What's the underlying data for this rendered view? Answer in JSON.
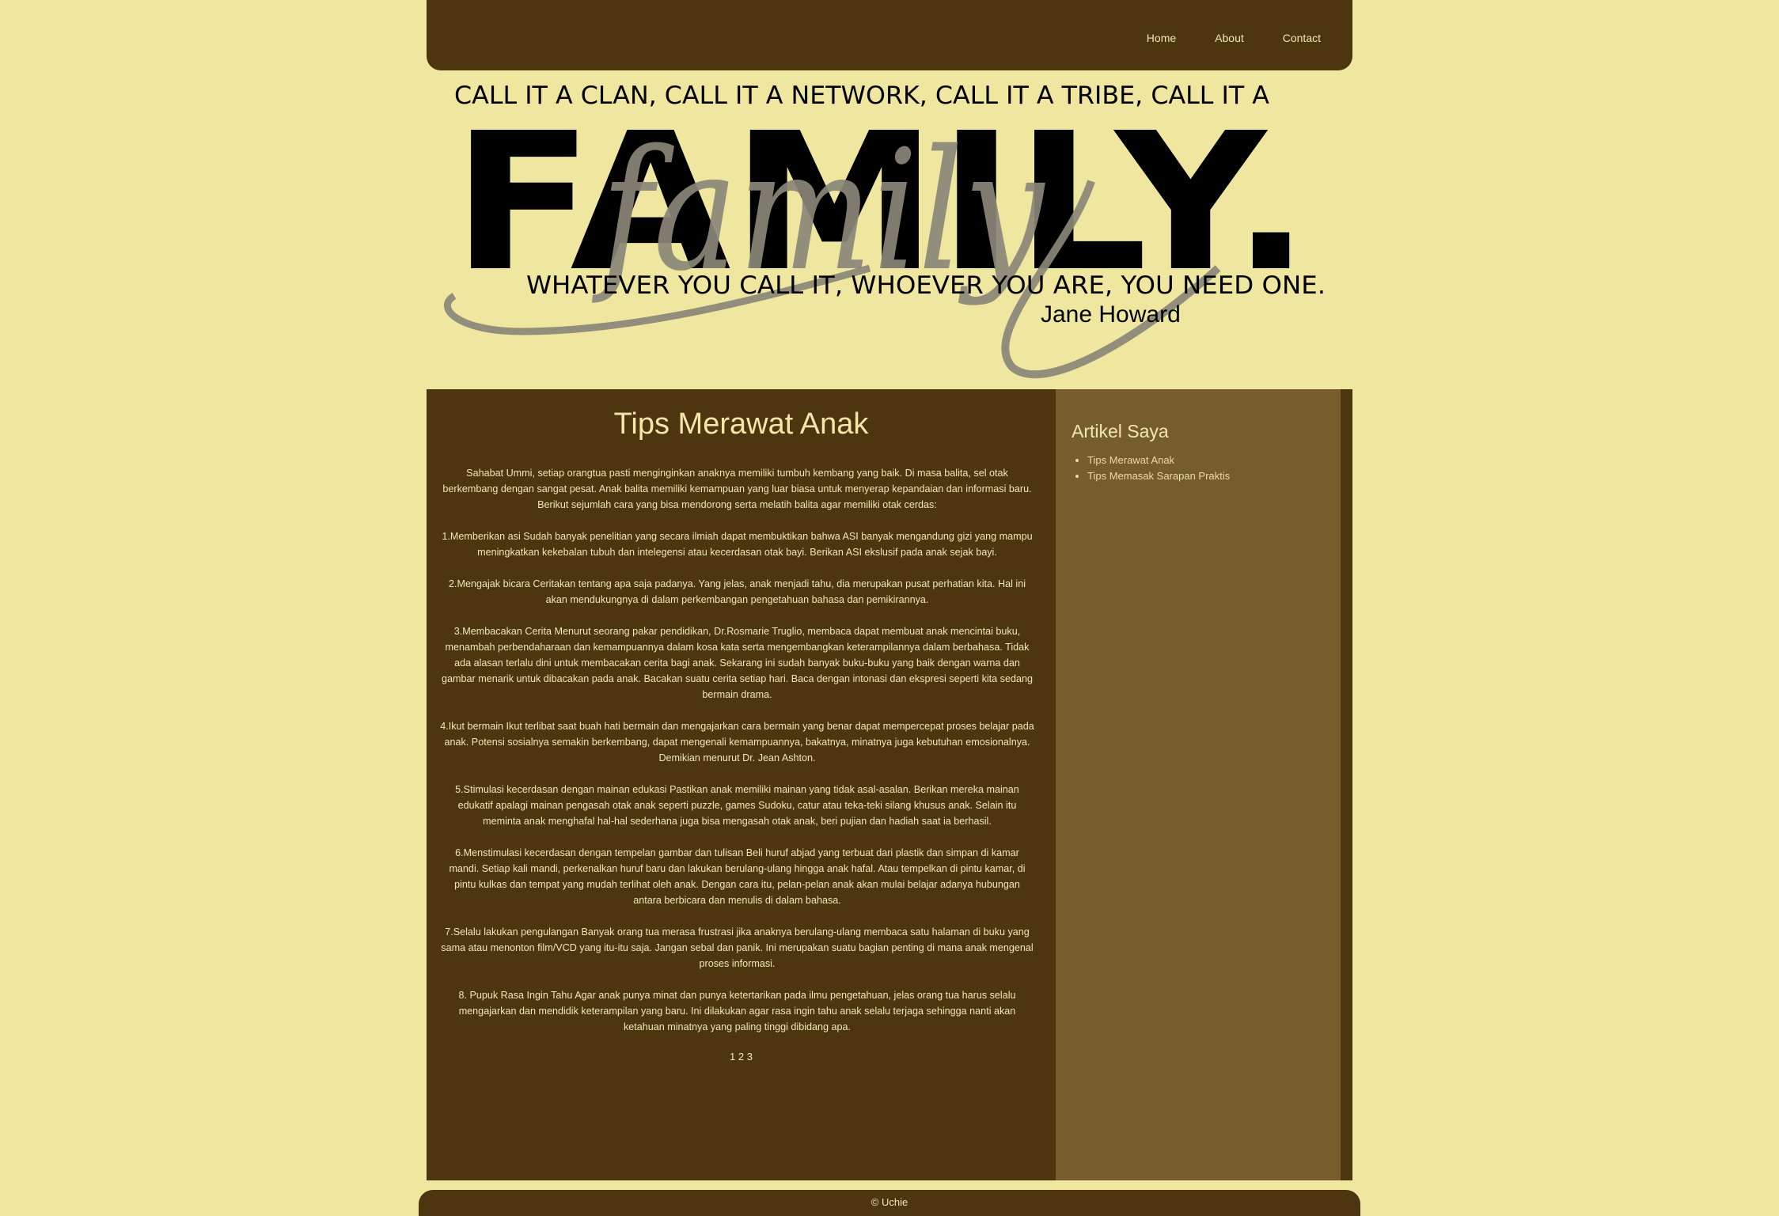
{
  "nav": {
    "home": "Home",
    "about": "About",
    "contact": "Contact"
  },
  "banner": {
    "top_line": "CALL IT A CLAN, CALL IT A NETWORK, CALL IT A TRIBE, CALL IT A",
    "big_word": "FAMILY.",
    "script_word": "family",
    "bottom_line": "WHATEVER YOU CALL IT, WHOEVER YOU ARE, YOU NEED ONE.",
    "author": "Jane Howard"
  },
  "main": {
    "title": "Tips Merawat Anak",
    "paragraphs": [
      "Sahabat Ummi, setiap orangtua pasti menginginkan anaknya memiliki tumbuh kembang yang baik. Di masa balita, sel otak berkembang dengan sangat pesat. Anak balita memiliki kemampuan yang luar biasa untuk menyerap kepandaian dan informasi baru. Berikut sejumlah cara yang bisa mendorong serta melatih balita agar memiliki otak cerdas:",
      "1.Memberikan asi Sudah banyak penelitian yang secara ilmiah dapat membuktikan bahwa ASI banyak mengandung gizi yang mampu meningkatkan kekebalan tubuh dan intelegensi atau kecerdasan otak bayi. Berikan ASI ekslusif pada anak sejak bayi.",
      "2.Mengajak bicara Ceritakan tentang apa saja padanya. Yang jelas, anak menjadi tahu, dia merupakan pusat perhatian kita. Hal ini akan mendukungnya di dalam perkembangan pengetahuan bahasa dan pemikirannya.",
      "3.Membacakan Cerita Menurut seorang pakar pendidikan, Dr.Rosmarie Truglio, membaca dapat membuat anak mencintai buku, menambah perbendaharaan dan kemampuannya dalam kosa kata serta mengembangkan keterampilannya dalam berbahasa. Tidak ada alasan terlalu dini untuk membacakan cerita bagi anak. Sekarang ini sudah banyak buku-buku yang baik dengan warna dan gambar menarik untuk dibacakan pada anak. Bacakan suatu cerita setiap hari. Baca dengan intonasi dan ekspresi seperti kita sedang bermain drama.",
      "4.Ikut bermain Ikut terlibat saat buah hati bermain dan mengajarkan cara bermain yang benar dapat mempercepat proses belajar pada anak. Potensi sosialnya semakin berkembang, dapat mengenali kemampuannya, bakatnya, minatnya juga kebutuhan emosionalnya. Demikian menurut Dr. Jean Ashton.",
      "5.Stimulasi kecerdasan dengan mainan edukasi Pastikan anak memiliki mainan yang tidak asal-asalan. Berikan mereka mainan edukatif apalagi mainan pengasah otak anak seperti puzzle, games Sudoku, catur atau teka-teki silang khusus anak. Selain itu meminta anak menghafal hal-hal sederhana juga bisa mengasah otak anak, beri pujian dan hadiah saat ia berhasil.",
      "6.Menstimulasi kecerdasan dengan tempelan gambar dan tulisan Beli huruf abjad yang terbuat dari plastik dan simpan di kamar mandi. Setiap kali mandi, perkenalkan huruf baru dan lakukan berulang-ulang hingga anak hafal. Atau tempelkan di pintu kamar, di pintu kulkas dan tempat yang mudah terlihat oleh anak. Dengan cara itu, pelan-pelan anak akan mulai belajar adanya hubungan antara berbicara dan menulis di dalam bahasa.",
      "7.Selalu lakukan pengulangan Banyak orang tua merasa frustrasi jika anaknya berulang-ulang membaca satu halaman di buku yang sama atau menonton film/VCD yang itu-itu saja. Jangan sebal dan panik. Ini merupakan suatu bagian penting di mana anak mengenal proses informasi.",
      "8. Pupuk Rasa Ingin Tahu Agar anak punya minat dan punya ketertarikan pada ilmu pengetahuan, jelas orang tua harus selalu mengajarkan dan mendidik keterampilan yang baru. Ini dilakukan agar rasa ingin tahu anak selalu terjaga sehingga nanti akan ketahuan minatnya yang paling tinggi dibidang apa."
    ],
    "pages": [
      "1",
      "2",
      "3"
    ]
  },
  "sidebar": {
    "title": "Artikel Saya",
    "links": [
      "Tips Merawat Anak",
      "Tips Memasak Sarapan Praktis"
    ]
  },
  "footer": {
    "text": "© Uchie"
  },
  "colors": {
    "background": "#efe79f",
    "dark_brown": "#4d3510",
    "sidebar_brown": "#765d2e"
  }
}
